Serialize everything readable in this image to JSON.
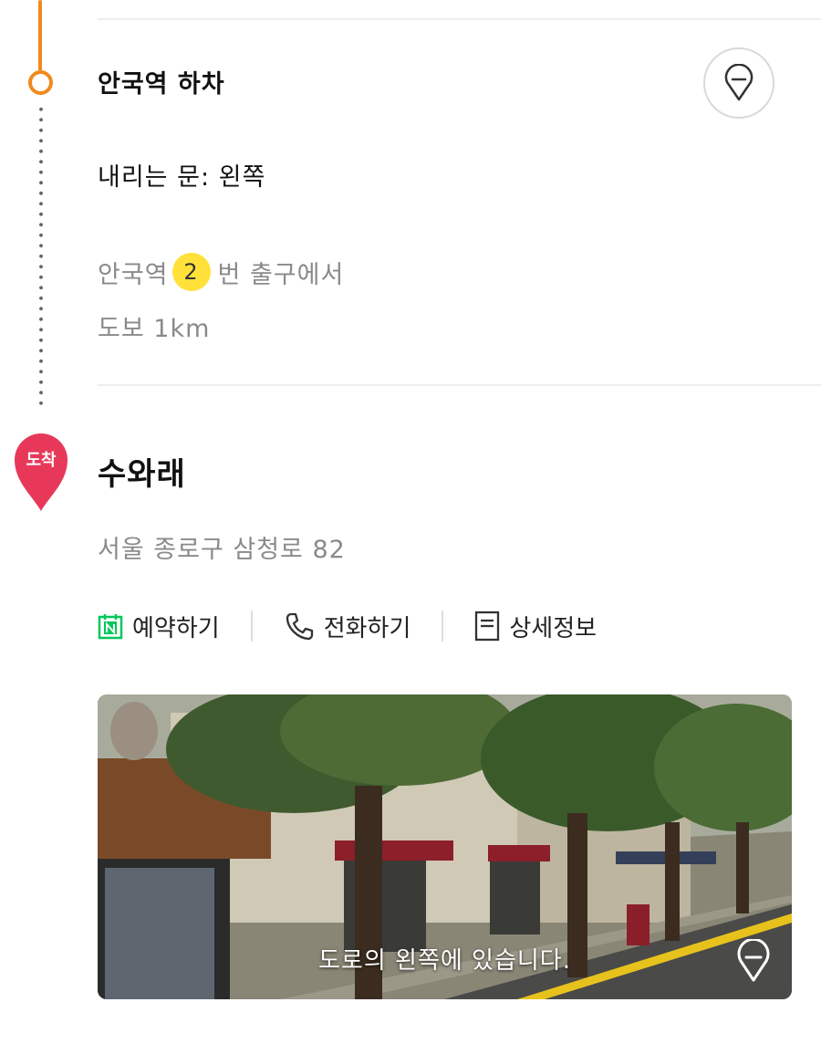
{
  "step": {
    "title": "안국역 하차",
    "door": "내리는 문: 왼쪽",
    "exit": {
      "prefix": "안국역",
      "number": "2",
      "suffix": "번 출구에서"
    },
    "walk": "도보 1km"
  },
  "destination": {
    "badge": "도착",
    "name": "수와래",
    "address": "서울 종로구 삼청로 82",
    "actions": [
      {
        "label": "예약하기",
        "icon": "naver-booking-icon"
      },
      {
        "label": "전화하기",
        "icon": "phone-icon"
      },
      {
        "label": "상세정보",
        "icon": "document-icon"
      }
    ],
    "photo_caption": "도로의 왼쪽에 있습니다."
  },
  "colors": {
    "route_orange": "#f08a1e",
    "destination_red": "#e8385a",
    "exit_badge_yellow": "#ffe13a",
    "naver_green": "#03c75a"
  }
}
